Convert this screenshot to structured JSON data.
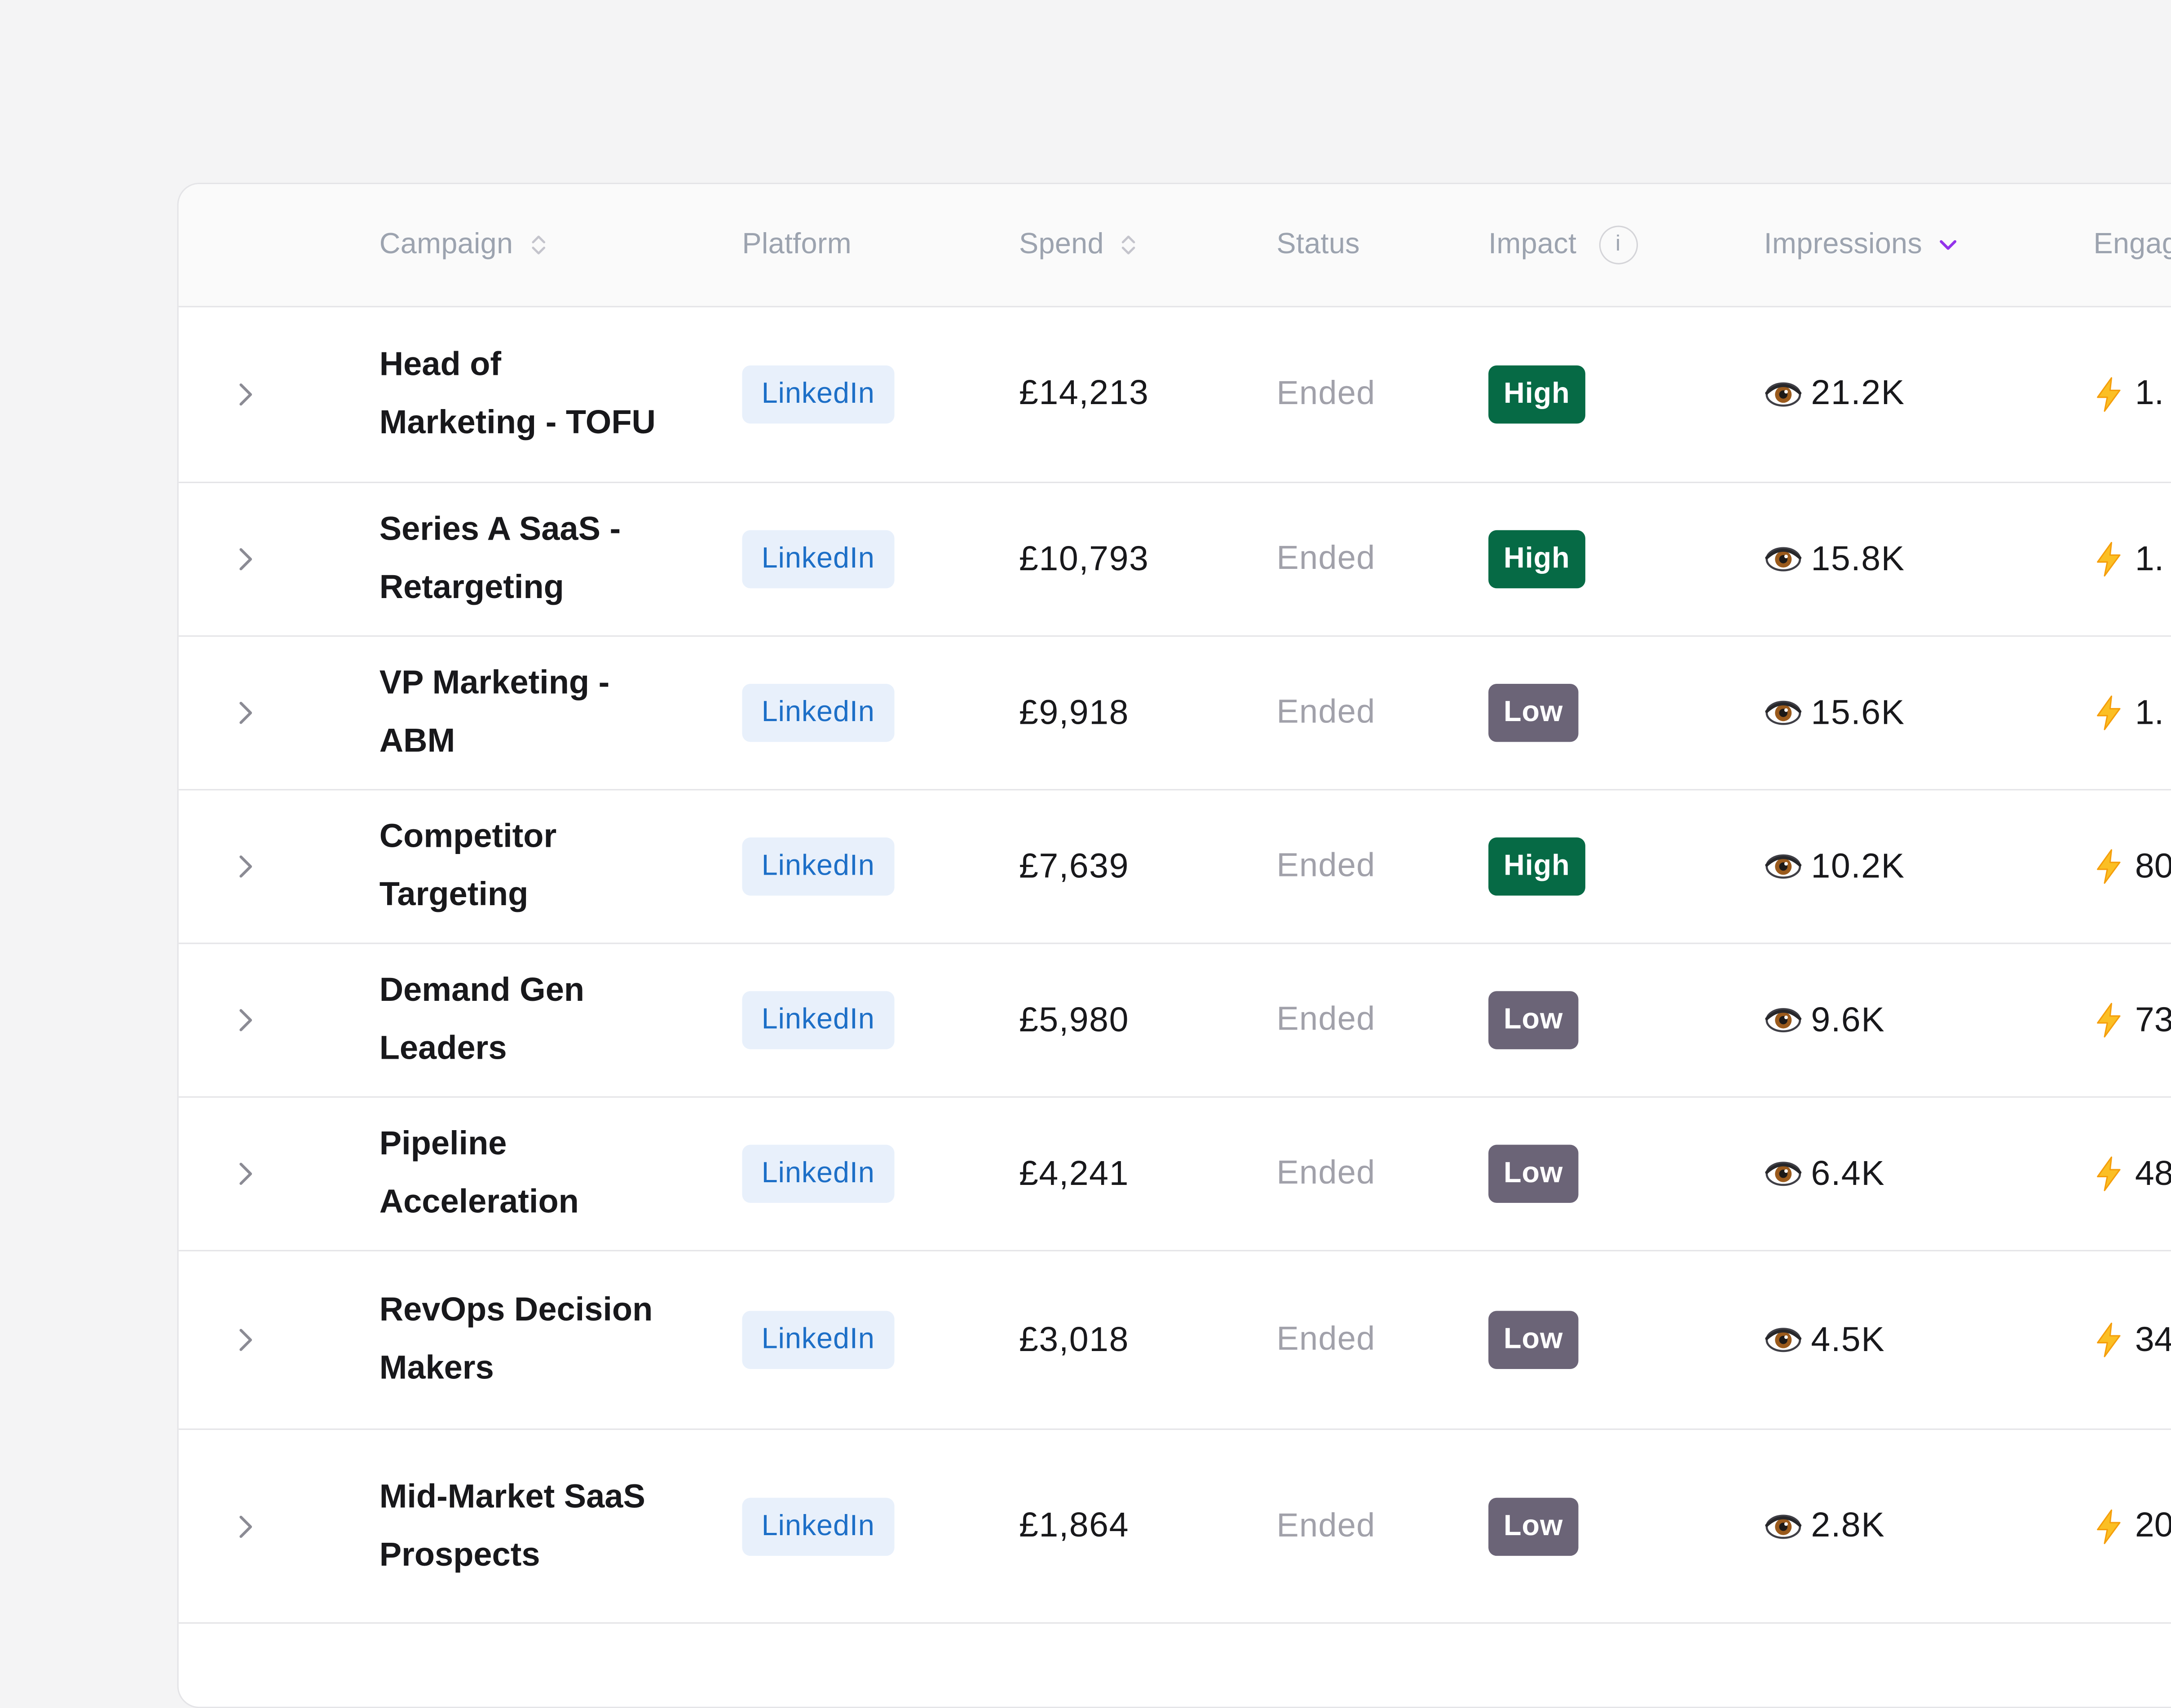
{
  "table": {
    "columns": {
      "campaign": "Campaign",
      "platform": "Platform",
      "spend": "Spend",
      "status": "Status",
      "impact": "Impact",
      "impressions": "Impressions",
      "engagement": "Engag"
    },
    "impact_info_glyph": "i",
    "rows": [
      {
        "campaign": "Head of Marketing - TOFU",
        "platform": "LinkedIn",
        "spend": "£14,213",
        "status": "Ended",
        "impact": "High",
        "impressions": "21.2K",
        "engagement": "1."
      },
      {
        "campaign": "Series A SaaS - Retargeting",
        "platform": "LinkedIn",
        "spend": "£10,793",
        "status": "Ended",
        "impact": "High",
        "impressions": "15.8K",
        "engagement": "1."
      },
      {
        "campaign": "VP Marketing - ABM",
        "platform": "LinkedIn",
        "spend": "£9,918",
        "status": "Ended",
        "impact": "Low",
        "impressions": "15.6K",
        "engagement": "1."
      },
      {
        "campaign": "Competitor Targeting",
        "platform": "LinkedIn",
        "spend": "£7,639",
        "status": "Ended",
        "impact": "High",
        "impressions": "10.2K",
        "engagement": "80"
      },
      {
        "campaign": "Demand Gen Leaders",
        "platform": "LinkedIn",
        "spend": "£5,980",
        "status": "Ended",
        "impact": "Low",
        "impressions": "9.6K",
        "engagement": "73"
      },
      {
        "campaign": "Pipeline Acceleration",
        "platform": "LinkedIn",
        "spend": "£4,241",
        "status": "Ended",
        "impact": "Low",
        "impressions": "6.4K",
        "engagement": "48"
      },
      {
        "campaign": "RevOps Decision Makers",
        "platform": "LinkedIn",
        "spend": "£3,018",
        "status": "Ended",
        "impact": "Low",
        "impressions": "4.5K",
        "engagement": "34"
      },
      {
        "campaign": "Mid-Market SaaS Prospects",
        "platform": "LinkedIn",
        "spend": "£1,864",
        "status": "Ended",
        "impact": "Low",
        "impressions": "2.8K",
        "engagement": "20"
      }
    ]
  },
  "colors": {
    "impact_high": "#066a45",
    "impact_low": "#6b6477",
    "sort_active": "#9333ea",
    "platform_badge_bg": "#e8f0fb",
    "platform_badge_text": "#1d6fc7"
  },
  "icons": {
    "row_expand": "chevron-right-icon",
    "sort": "sort-icon",
    "sort_active": "chevron-down-icon",
    "info": "info-icon",
    "impressions": "eye-icon",
    "engagement": "bolt-icon"
  }
}
